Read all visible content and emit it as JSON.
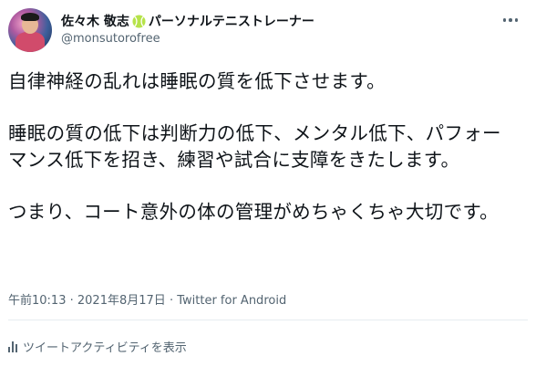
{
  "header": {
    "display_name": "佐々木 敬志",
    "display_name_suffix": "パーソナルテニストレーナー",
    "handle": "@monsutorofree"
  },
  "tweet": {
    "paragraphs": [
      "自律神経の乱れは睡眠の質を低下させます。",
      "睡眠の質の低下は判断力の低下、メンタル低下、パフォーマンス低下を招き、練習や試合に支障をきたします。",
      "つまり、コート意外の体の管理がめちゃくちゃ大切です。"
    ],
    "time": "午前10:13",
    "date": "2021年8月17日",
    "source": "Twitter for Android",
    "separator": "·"
  },
  "footer": {
    "activity_label": "ツイートアクティビティを表示"
  },
  "icons": {
    "avatar": "avatar-photo",
    "name_emoji": "tennis-ball-icon",
    "more": "more-horizontal-icon",
    "activity": "bar-chart-icon"
  },
  "colors": {
    "text": "#0f1419",
    "secondary": "#536471",
    "divider": "#e6ecf0",
    "tennis_ball": "#b6e34a"
  }
}
